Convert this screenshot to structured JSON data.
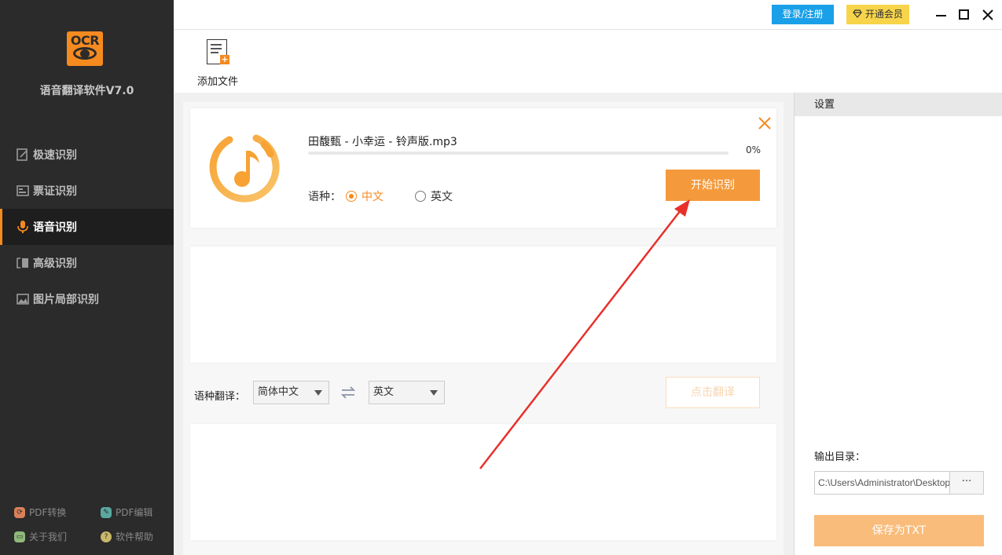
{
  "app": {
    "logo_text": "OCR",
    "name": "语音翻译软件V7.0",
    "accent": "#f58a1f"
  },
  "sidebar": {
    "items": [
      {
        "label": "极速识别",
        "icon": "scan-icon"
      },
      {
        "label": "票证识别",
        "icon": "card-icon"
      },
      {
        "label": "语音识别",
        "icon": "microphone-icon",
        "active": true
      },
      {
        "label": "高级识别",
        "icon": "advanced-icon"
      },
      {
        "label": "图片局部识别",
        "icon": "image-icon"
      }
    ],
    "footer": {
      "pdf_convert": "PDF转换",
      "pdf_edit": "PDF编辑",
      "about": "关于我们",
      "help": "软件帮助"
    }
  },
  "topbar": {
    "login": "登录/注册",
    "vip": "开通会员"
  },
  "toolbar": {
    "add_file": "添加文件"
  },
  "file_card": {
    "file_name": "田馥甄 - 小幸运 - 铃声版.mp3",
    "progress_percent": 0,
    "progress_text": "0%",
    "lang_label": "语种：",
    "lang_options": [
      "中文",
      "英文"
    ],
    "selected_lang": "中文",
    "start_button": "开始识别"
  },
  "translate": {
    "label": "语种翻译：",
    "source_lang": "简体中文",
    "target_lang": "英文",
    "button": "点击翻译"
  },
  "settings": {
    "title": "设置",
    "output_label": "输出目录：",
    "output_path": "C:\\Users\\Administrator\\Desktop",
    "browse": "···",
    "save_button": "保存为TXT"
  }
}
